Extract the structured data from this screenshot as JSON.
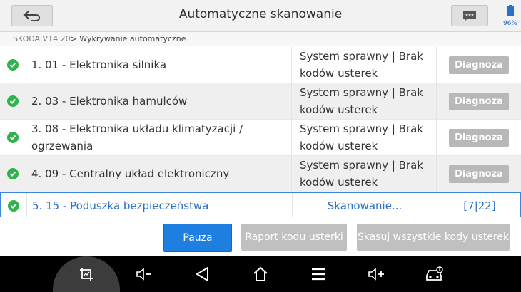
{
  "header": {
    "title": "Automatyczne skanowanie",
    "battery_pct": "96%"
  },
  "breadcrumb": {
    "version": "SKODA V14.20",
    "separator": ">",
    "current": " Wykrywanie automatyczne"
  },
  "rows": [
    {
      "name": "1. 01 - Elektronika silnika",
      "state": "System sprawny | Brak kodów usterek",
      "action": "Diagnoza"
    },
    {
      "name": "2. 03 - Elektronika hamulców",
      "state": "System sprawny | Brak kodów usterek",
      "action": "Diagnoza"
    },
    {
      "name": "3. 08 - Elektronika układu klimatyzacji / ogrzewania",
      "state": "System sprawny | Brak kodów usterek",
      "action": "Diagnoza"
    },
    {
      "name": "4. 09 - Centralny układ elektroniczny",
      "state": "System sprawny | Brak kodów usterek",
      "action": "Diagnoza"
    },
    {
      "name": "5. 15 - Poduszka bezpieczeństwa",
      "state": "Skanowanie...",
      "action": "[7|22]"
    }
  ],
  "buttons": {
    "pause": "Pauza",
    "report": "Raport kodu usterki",
    "clear": "Skasuj wszystkie kody usterek"
  },
  "colors": {
    "accent": "#1f7fe0",
    "ok": "#2fb34a",
    "disabled": "#c0c0c0"
  },
  "icons": {
    "back": "back-arrow-icon",
    "message": "message-icon",
    "battery": "battery-icon",
    "status": "check-circle-icon",
    "nav": [
      "screenshot-icon",
      "volume-down-icon",
      "back-triangle-icon",
      "home-icon",
      "menu-icon",
      "volume-up-icon",
      "vehicle-diagnostic-icon"
    ]
  }
}
